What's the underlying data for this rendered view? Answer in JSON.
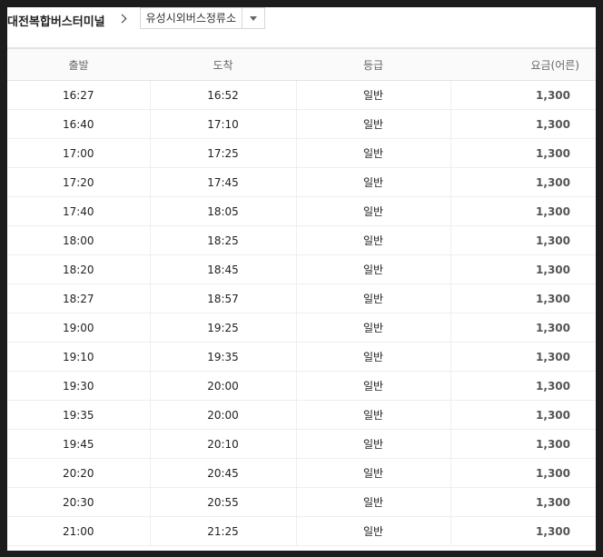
{
  "route": {
    "origin": "대전복합버스터미널",
    "destination": "유성시외버스정류소"
  },
  "table": {
    "headers": {
      "departure": "출발",
      "arrival": "도착",
      "grade": "등급",
      "fare": "요금(어른)"
    },
    "rows": [
      {
        "departure": "16:27",
        "arrival": "16:52",
        "grade": "일반",
        "fare": "1,300"
      },
      {
        "departure": "16:40",
        "arrival": "17:10",
        "grade": "일반",
        "fare": "1,300"
      },
      {
        "departure": "17:00",
        "arrival": "17:25",
        "grade": "일반",
        "fare": "1,300"
      },
      {
        "departure": "17:20",
        "arrival": "17:45",
        "grade": "일반",
        "fare": "1,300"
      },
      {
        "departure": "17:40",
        "arrival": "18:05",
        "grade": "일반",
        "fare": "1,300"
      },
      {
        "departure": "18:00",
        "arrival": "18:25",
        "grade": "일반",
        "fare": "1,300"
      },
      {
        "departure": "18:20",
        "arrival": "18:45",
        "grade": "일반",
        "fare": "1,300"
      },
      {
        "departure": "18:27",
        "arrival": "18:57",
        "grade": "일반",
        "fare": "1,300"
      },
      {
        "departure": "19:00",
        "arrival": "19:25",
        "grade": "일반",
        "fare": "1,300"
      },
      {
        "departure": "19:10",
        "arrival": "19:35",
        "grade": "일반",
        "fare": "1,300"
      },
      {
        "departure": "19:30",
        "arrival": "20:00",
        "grade": "일반",
        "fare": "1,300"
      },
      {
        "departure": "19:35",
        "arrival": "20:00",
        "grade": "일반",
        "fare": "1,300"
      },
      {
        "departure": "19:45",
        "arrival": "20:10",
        "grade": "일반",
        "fare": "1,300"
      },
      {
        "departure": "20:20",
        "arrival": "20:45",
        "grade": "일반",
        "fare": "1,300"
      },
      {
        "departure": "20:30",
        "arrival": "20:55",
        "grade": "일반",
        "fare": "1,300"
      },
      {
        "departure": "21:00",
        "arrival": "21:25",
        "grade": "일반",
        "fare": "1,300"
      }
    ]
  }
}
